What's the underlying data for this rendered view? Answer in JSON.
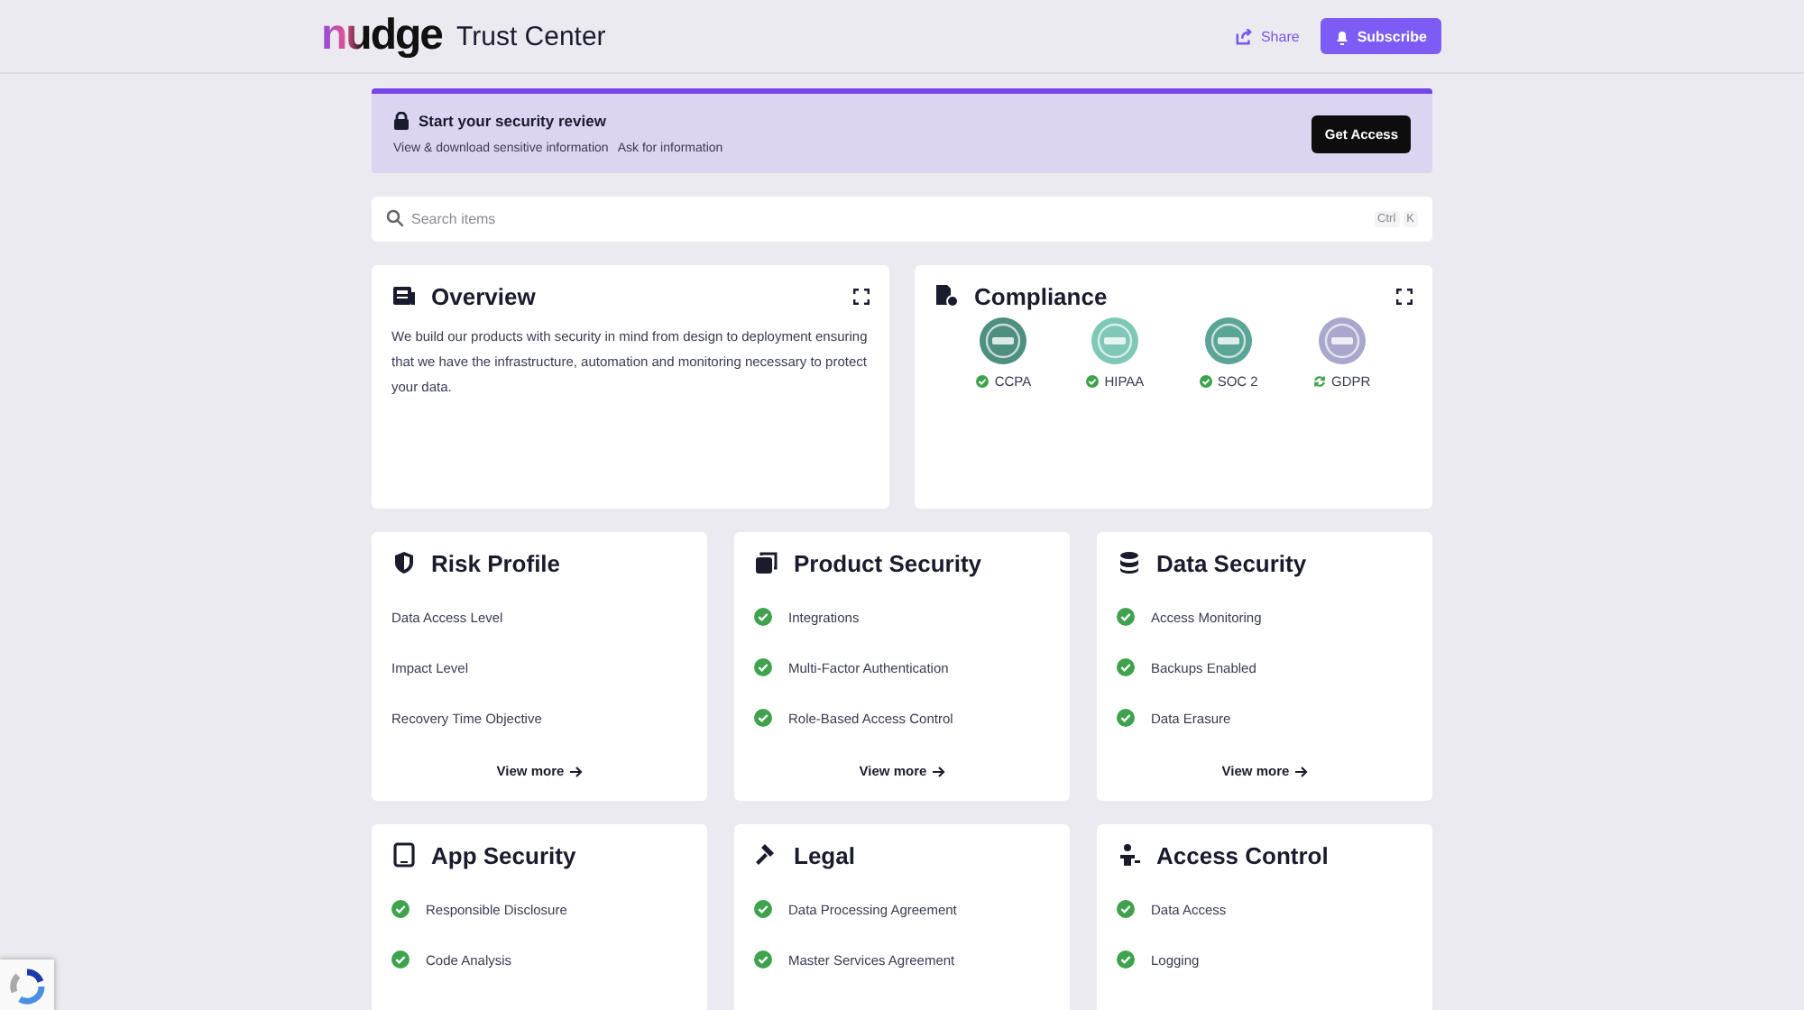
{
  "header": {
    "logo": "nudge",
    "title": "Trust Center",
    "share": "Share",
    "subscribe": "Subscribe"
  },
  "banner": {
    "title": "Start your security review",
    "links": [
      "View & download sensitive information",
      "Ask for information"
    ],
    "button": "Get Access"
  },
  "search": {
    "placeholder": "Search items",
    "shortcut": [
      "Ctrl",
      "K"
    ]
  },
  "overview": {
    "title": "Overview",
    "text": "We build our products with security in mind from design to deployment ensuring that we have the infrastructure, automation and monitoring necessary to protect your data."
  },
  "compliance": {
    "title": "Compliance",
    "badges": [
      {
        "label": "CCPA",
        "kind": "compliant",
        "color": "#4e8f80"
      },
      {
        "label": "HIPAA",
        "kind": "compliant",
        "color": "#7fc8b8"
      },
      {
        "label": "SOC 2",
        "kind": "compliant",
        "color": "#5aa596"
      },
      {
        "label": "GDPR",
        "kind": "pending",
        "color": "#a9a7cc"
      }
    ]
  },
  "cards": [
    {
      "title": "Risk Profile",
      "kind": "shield",
      "checked": false,
      "items": [
        "Data Access Level",
        "Impact Level",
        "Recovery Time Objective"
      ],
      "more": "View more"
    },
    {
      "title": "Product Security",
      "kind": "stack",
      "checked": true,
      "items": [
        "Integrations",
        "Multi-Factor Authentication",
        "Role-Based Access Control"
      ],
      "more": "View more"
    },
    {
      "title": "Data Security",
      "kind": "database",
      "checked": true,
      "items": [
        "Access Monitoring",
        "Backups Enabled",
        "Data Erasure"
      ],
      "more": "View more"
    },
    {
      "title": "App Security",
      "kind": "tablet",
      "checked": true,
      "items": [
        "Responsible Disclosure",
        "Code Analysis"
      ]
    },
    {
      "title": "Legal",
      "kind": "gavel",
      "checked": true,
      "items": [
        "Data Processing Agreement",
        "Master Services Agreement"
      ]
    },
    {
      "title": "Access Control",
      "kind": "person",
      "checked": true,
      "items": [
        "Data Access",
        "Logging"
      ]
    }
  ]
}
